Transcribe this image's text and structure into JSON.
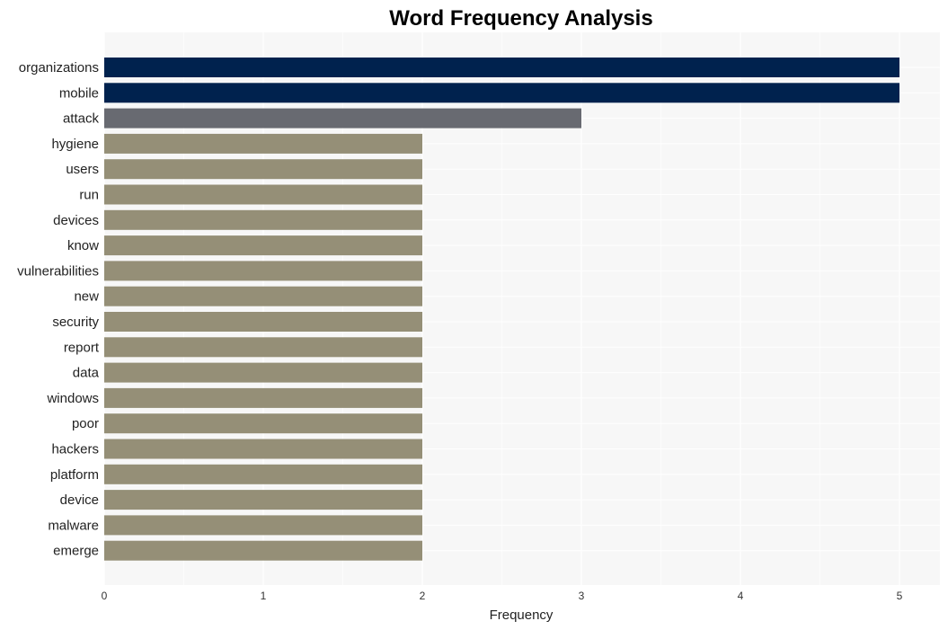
{
  "chart_data": {
    "type": "bar",
    "orientation": "horizontal",
    "title": "Word Frequency Analysis",
    "xlabel": "Frequency",
    "ylabel": "",
    "xlim": [
      0,
      5.25
    ],
    "xticks": [
      0,
      1,
      2,
      3,
      4,
      5
    ],
    "grid": true,
    "categories": [
      "organizations",
      "mobile",
      "attack",
      "hygiene",
      "users",
      "run",
      "devices",
      "know",
      "vulnerabilities",
      "new",
      "security",
      "report",
      "data",
      "windows",
      "poor",
      "hackers",
      "platform",
      "device",
      "malware",
      "emerge"
    ],
    "values": [
      5,
      5,
      3,
      2,
      2,
      2,
      2,
      2,
      2,
      2,
      2,
      2,
      2,
      2,
      2,
      2,
      2,
      2,
      2,
      2
    ],
    "colors": {
      "top": "#00224e",
      "mid": "#686a71",
      "rest": "#958f77",
      "panel": "#f7f7f7",
      "grid": "#ffffff"
    }
  }
}
